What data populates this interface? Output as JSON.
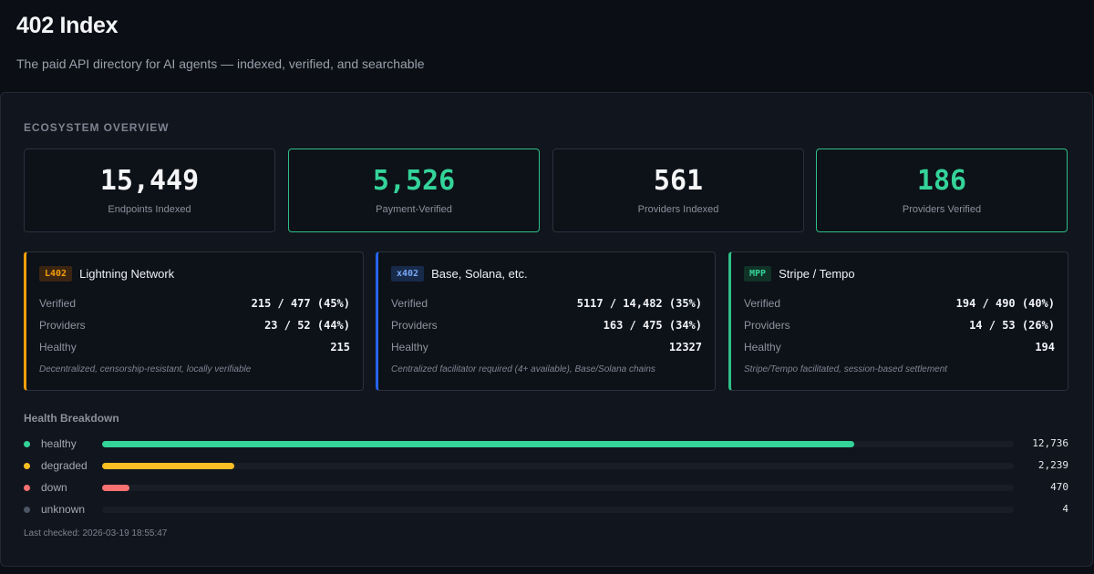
{
  "header": {
    "title": "402 Index",
    "subtitle": "The paid API directory for AI agents — indexed, verified, and searchable"
  },
  "overview": {
    "section_label": "ECOSYSTEM OVERVIEW",
    "stats": [
      {
        "value": "15,449",
        "label": "Endpoints Indexed",
        "accent": false
      },
      {
        "value": "5,526",
        "label": "Payment-Verified",
        "accent": true
      },
      {
        "value": "561",
        "label": "Providers Indexed",
        "accent": false
      },
      {
        "value": "186",
        "label": "Providers Verified",
        "accent": true
      }
    ]
  },
  "protocols": [
    {
      "badge": "L402",
      "name": "Lightning Network",
      "accent": "#f59e0b",
      "badge_bg": "#3a2512",
      "badge_fg": "#f59e0b",
      "rows": [
        {
          "label": "Verified",
          "value": "215 / 477 (45%)"
        },
        {
          "label": "Providers",
          "value": "23 / 52 (44%)"
        },
        {
          "label": "Healthy",
          "value": "215"
        }
      ],
      "note": "Decentralized, censorship-resistant, locally verifiable"
    },
    {
      "badge": "x402",
      "name": "Base, Solana, etc.",
      "accent": "#2563eb",
      "badge_bg": "#172a4a",
      "badge_fg": "#7aa7f5",
      "rows": [
        {
          "label": "Verified",
          "value": "5117 / 14,482 (35%)"
        },
        {
          "label": "Providers",
          "value": "163 / 475 (34%)"
        },
        {
          "label": "Healthy",
          "value": "12327"
        }
      ],
      "note": "Centralized facilitator required (4+ available), Base/Solana chains"
    },
    {
      "badge": "MPP",
      "name": "Stripe / Tempo",
      "accent": "#2fbf87",
      "badge_bg": "#113227",
      "badge_fg": "#34d399",
      "rows": [
        {
          "label": "Verified",
          "value": "194 / 490 (40%)"
        },
        {
          "label": "Providers",
          "value": "14 / 53 (26%)"
        },
        {
          "label": "Healthy",
          "value": "194"
        }
      ],
      "note": "Stripe/Tempo facilitated, session-based settlement"
    }
  ],
  "health": {
    "title": "Health Breakdown",
    "rows": [
      {
        "label": "healthy",
        "count": "12,736",
        "fraction": 0.825,
        "color": "#34d399"
      },
      {
        "label": "degraded",
        "count": "2,239",
        "fraction": 0.145,
        "color": "#fbbf24"
      },
      {
        "label": "down",
        "count": "470",
        "fraction": 0.03,
        "color": "#f87171"
      },
      {
        "label": "unknown",
        "count": "4",
        "fraction": 0.0,
        "color": "#4b5563"
      }
    ],
    "last_checked": "Last checked: 2026-03-19 18:55:47"
  }
}
